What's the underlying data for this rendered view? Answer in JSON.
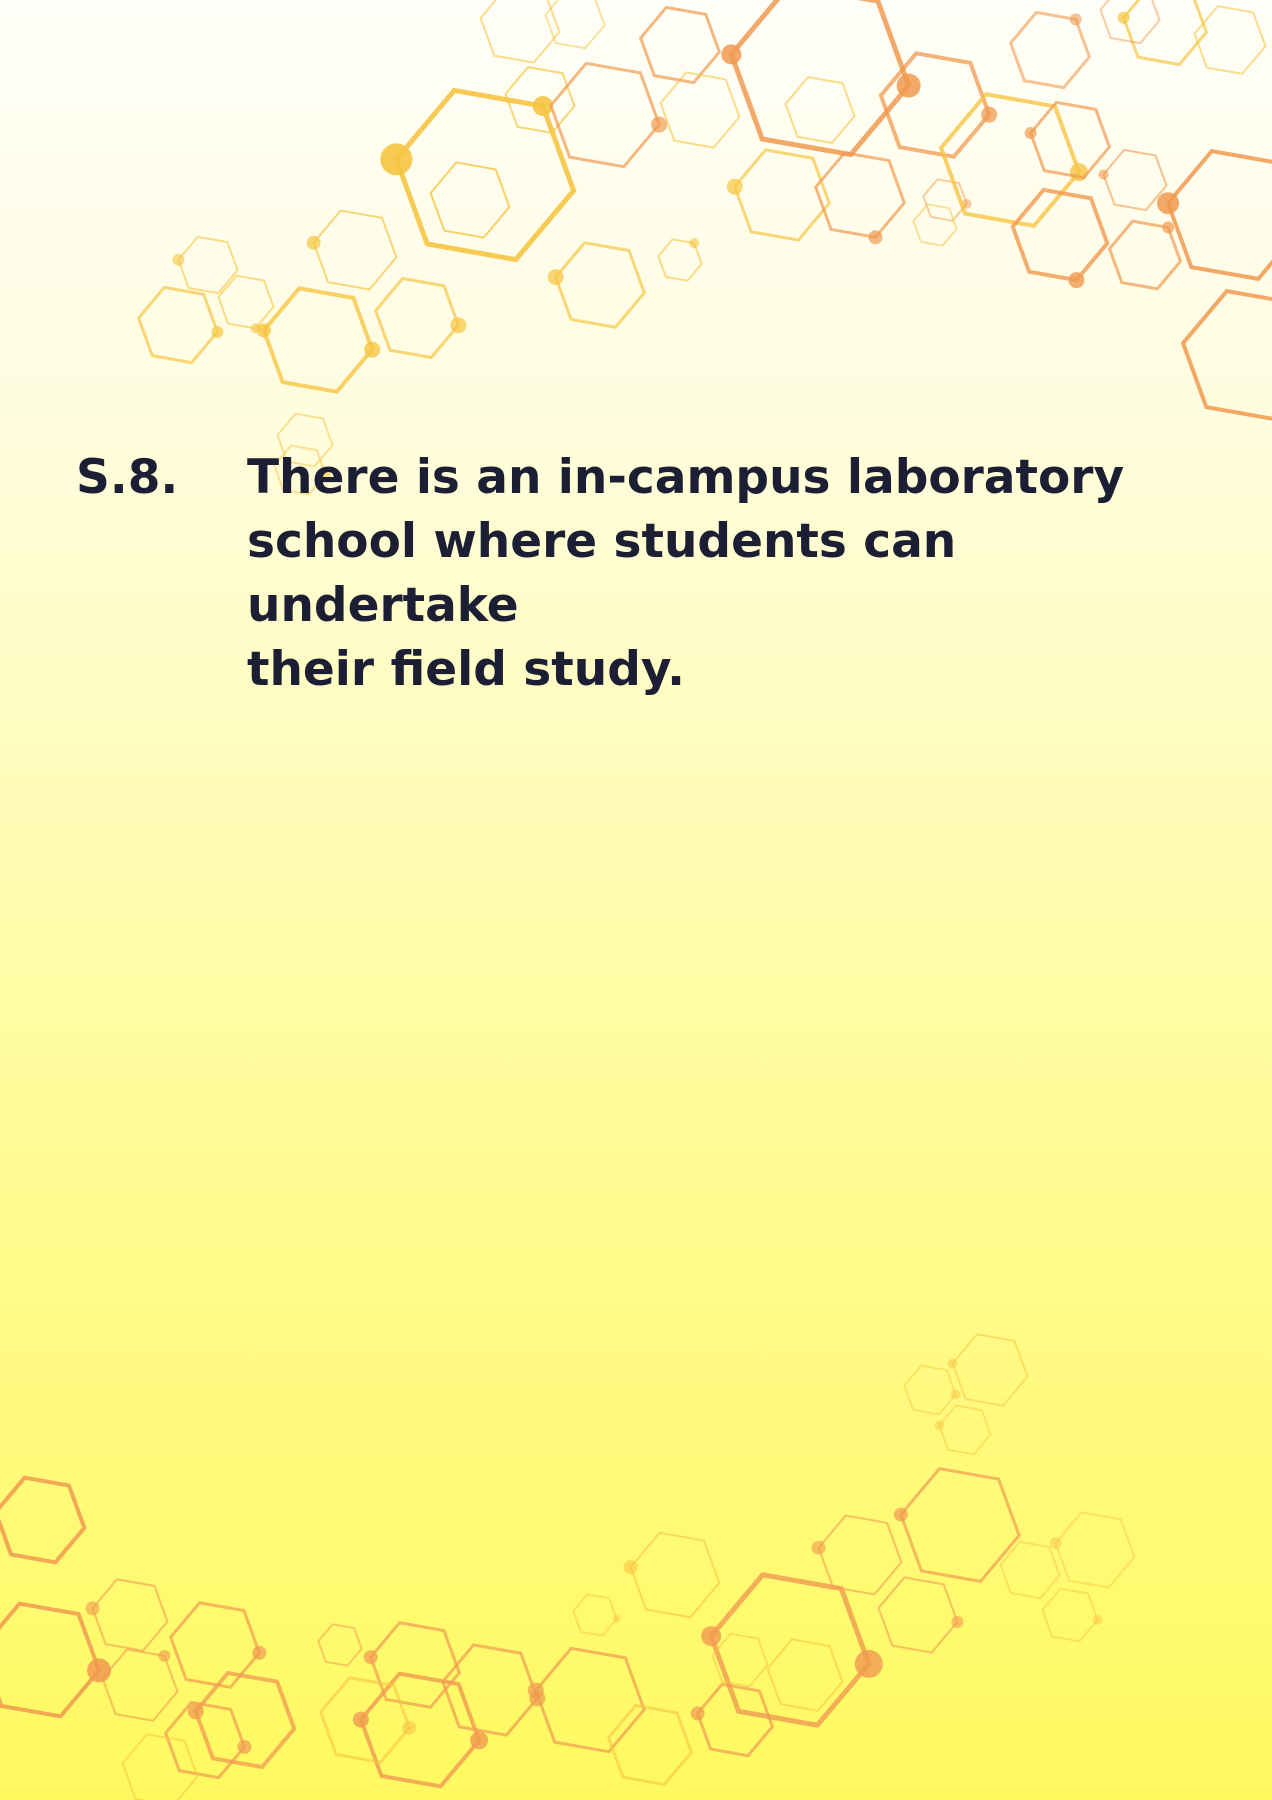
{
  "statement": {
    "number": "S.8.",
    "lines": [
      "There is an in-campus laboratory",
      "school where students can undertake",
      "their field study."
    ]
  },
  "colors": {
    "text": "#1c1f33",
    "hex_yellow": "#f6c443",
    "hex_orange": "#f09a50",
    "background_top": "#fffef8",
    "background_bottom": "#fff960"
  }
}
